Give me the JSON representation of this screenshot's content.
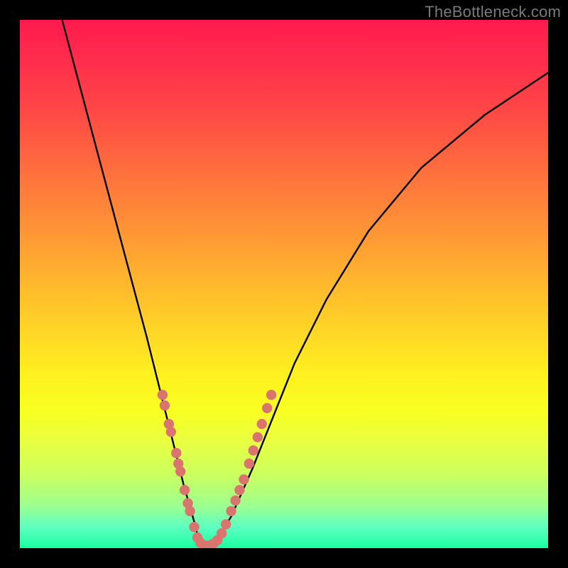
{
  "watermark": "TheBottleneck.com",
  "chart_data": {
    "type": "line",
    "title": "",
    "xlabel": "",
    "ylabel": "",
    "xlim": [
      0,
      100
    ],
    "ylim": [
      0,
      100
    ],
    "legend": false,
    "background_gradient": {
      "top_color": "#ff1a4f",
      "mid_color": "#fff020",
      "bottom_color": "#1aff9f",
      "meaning": "red=high bottleneck, green=low bottleneck"
    },
    "series": [
      {
        "name": "bottleneck-curve",
        "color": "#000000",
        "x": [
          8,
          12,
          16,
          20,
          24,
          27,
          29,
          31,
          33,
          34,
          35,
          37,
          40,
          44,
          48,
          52,
          58,
          66,
          76,
          88,
          100
        ],
        "values": [
          100,
          85,
          70,
          55,
          40,
          28,
          20,
          12,
          5,
          1,
          0,
          1,
          6,
          15,
          25,
          35,
          47,
          60,
          72,
          82,
          90
        ]
      }
    ],
    "marker_clusters": [
      {
        "name": "left-arm-markers",
        "color": "#d9746e",
        "points": [
          {
            "x": 27.0,
            "y": 29
          },
          {
            "x": 27.4,
            "y": 27
          },
          {
            "x": 28.2,
            "y": 23.5
          },
          {
            "x": 28.6,
            "y": 22
          },
          {
            "x": 29.6,
            "y": 18
          },
          {
            "x": 30.0,
            "y": 16
          },
          {
            "x": 30.4,
            "y": 14.5
          },
          {
            "x": 31.2,
            "y": 11
          },
          {
            "x": 31.8,
            "y": 8.5
          },
          {
            "x": 32.2,
            "y": 7
          },
          {
            "x": 33.0,
            "y": 4
          },
          {
            "x": 33.6,
            "y": 2
          },
          {
            "x": 34.2,
            "y": 1
          },
          {
            "x": 35.0,
            "y": 0.5
          },
          {
            "x": 35.8,
            "y": 0.5
          },
          {
            "x": 36.6,
            "y": 0.8
          }
        ]
      },
      {
        "name": "right-arm-markers",
        "color": "#d9746e",
        "points": [
          {
            "x": 37.4,
            "y": 1.5
          },
          {
            "x": 38.2,
            "y": 2.8
          },
          {
            "x": 39.0,
            "y": 4.5
          },
          {
            "x": 40.0,
            "y": 7
          },
          {
            "x": 40.8,
            "y": 9
          },
          {
            "x": 41.6,
            "y": 11
          },
          {
            "x": 42.4,
            "y": 13
          },
          {
            "x": 43.4,
            "y": 16
          },
          {
            "x": 44.2,
            "y": 18.5
          },
          {
            "x": 45.0,
            "y": 21
          },
          {
            "x": 45.8,
            "y": 23.5
          },
          {
            "x": 46.8,
            "y": 26.5
          },
          {
            "x": 47.6,
            "y": 29
          }
        ]
      }
    ]
  }
}
